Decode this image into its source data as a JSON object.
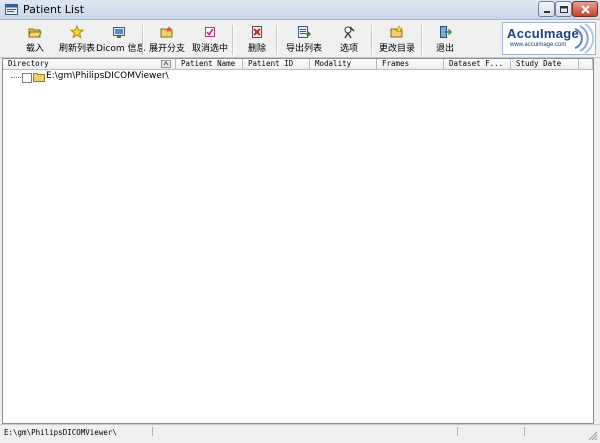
{
  "window": {
    "title": "Patient List",
    "colors": {
      "titlebar": "#c9d7ea",
      "close_button": "#c4422f",
      "logo_blue": "#1d3c8c"
    }
  },
  "toolbar": {
    "buttons": [
      {
        "label": "载入",
        "icon": "folder-open-icon"
      },
      {
        "label": "刷新列表",
        "icon": "refresh-star-icon"
      },
      {
        "label": "Dicom 信息",
        "icon": "info-monitor-icon"
      },
      {
        "label": "展开分支",
        "icon": "expand-branch-icon"
      },
      {
        "label": "取消选中",
        "icon": "checkbox-icon"
      },
      {
        "label": "删除",
        "icon": "delete-icon"
      },
      {
        "label": "导出列表",
        "icon": "export-list-icon"
      },
      {
        "label": "选项",
        "icon": "options-icon"
      },
      {
        "label": "更改目录",
        "icon": "change-directory-icon"
      },
      {
        "label": "退出",
        "icon": "exit-icon"
      }
    ],
    "logo": {
      "name": "AccuImage",
      "url": "www.accuimage.com"
    }
  },
  "list": {
    "columns": [
      "Directory",
      "Patient Name",
      "Patient ID",
      "Modality",
      "Frames",
      "Dataset F...",
      "Study Date"
    ],
    "tree": [
      {
        "label": "E:\\gm\\PhilipsDICOMViewer\\",
        "checked": false
      }
    ]
  },
  "status": {
    "path": "E:\\gm\\PhilipsDICOMViewer\\"
  }
}
